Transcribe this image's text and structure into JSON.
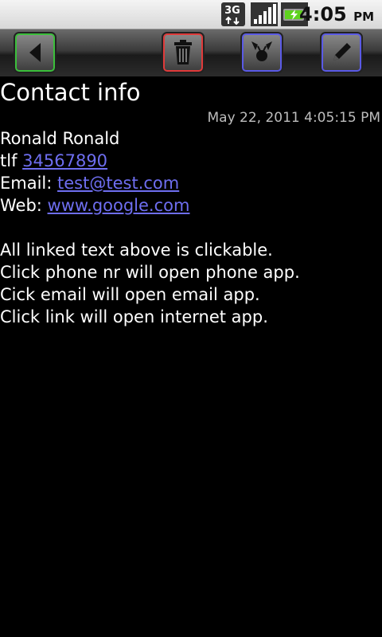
{
  "status_bar": {
    "time": "4:05",
    "ampm": "PM",
    "network_type": "3G",
    "icons": [
      "3g-data-icon",
      "signal-strength-icon",
      "battery-charging-icon"
    ]
  },
  "toolbar": {
    "buttons": [
      {
        "name": "back",
        "icon": "back-arrow-icon",
        "accent": "#3bbf3b"
      },
      {
        "name": "delete",
        "icon": "trash-icon",
        "accent": "#e03a3a"
      },
      {
        "name": "share",
        "icon": "share-contact-icon",
        "accent": "#5a5ae6"
      },
      {
        "name": "edit",
        "icon": "pencil-icon",
        "accent": "#5a5ae6"
      }
    ]
  },
  "contact": {
    "title": "Contact info",
    "timestamp": "May 22, 2011 4:05:15 PM",
    "name": "Ronald Ronald",
    "phone_label": "tlf",
    "phone": "34567890",
    "email_label": "Email:",
    "email": "test@test.com",
    "web_label": "Web:",
    "web": "www.google.com"
  },
  "notes": [
    "All linked text above is clickable.",
    "Click phone nr will open phone app.",
    "Cick email will open email app.",
    "Click link will open internet app."
  ],
  "colors": {
    "link": "#6e6ef0",
    "background": "#000000",
    "text": "#ffffff"
  }
}
